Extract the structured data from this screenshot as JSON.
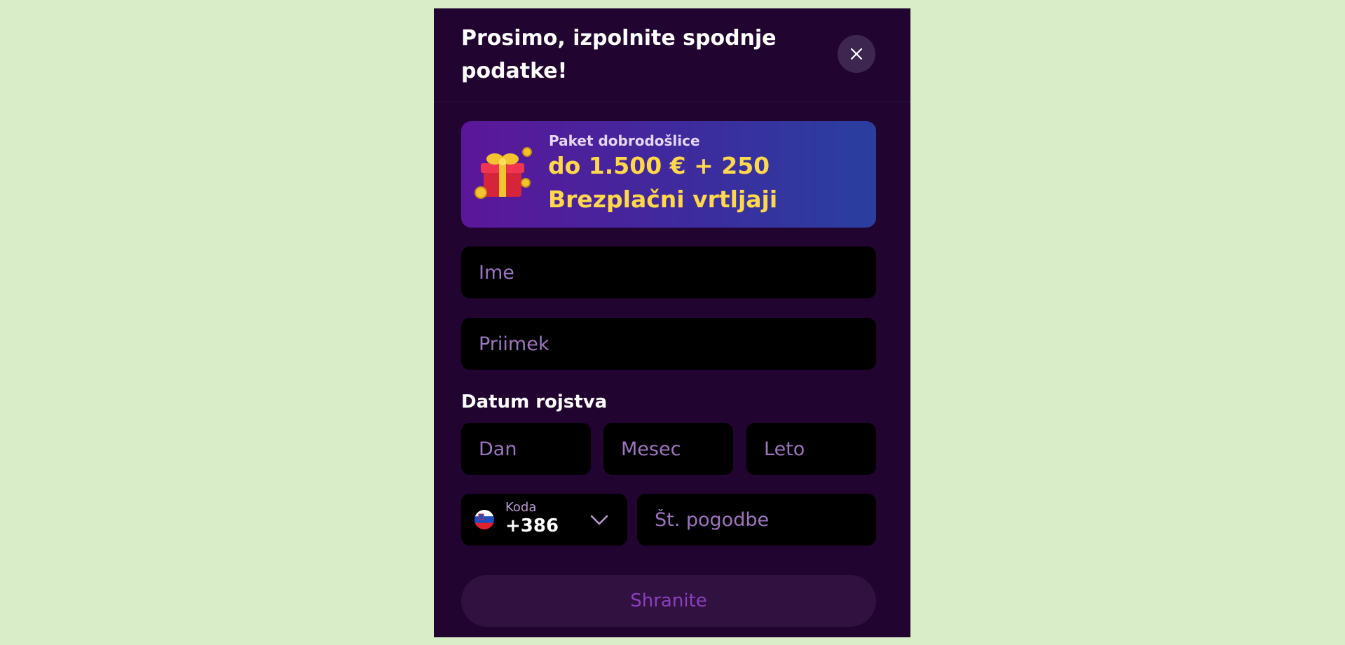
{
  "modal": {
    "title": "Prosimo, izpolnite spodnje podatke!",
    "close_icon": "close-icon"
  },
  "banner": {
    "icon": "gift-icon",
    "subtitle": "Paket dobrodošlice",
    "line1": "do 1.500 € + 250",
    "line2": "Brezplačni vrtljaji"
  },
  "form": {
    "first_name": {
      "value": "",
      "placeholder": "Ime"
    },
    "last_name": {
      "value": "",
      "placeholder": "Priimek"
    },
    "dob_label": "Datum rojstva",
    "dob_day": {
      "value": "",
      "placeholder": "Dan"
    },
    "dob_month": {
      "value": "",
      "placeholder": "Mesec"
    },
    "dob_year": {
      "value": "",
      "placeholder": "Leto"
    },
    "phone_code": {
      "label": "Koda",
      "value": "+386",
      "flag_icon": "slovenia-flag-icon",
      "chevron_icon": "chevron-down-icon"
    },
    "phone_number": {
      "value": "",
      "placeholder": "Št. pogodbe"
    },
    "save_label": "Shranite"
  },
  "colors": {
    "page_background": "#d9eec8",
    "modal_background": "#21042f",
    "accent_yellow": "#ffd84a",
    "placeholder": "#9d74c0",
    "button_disabled_text": "#8a3fbf"
  }
}
